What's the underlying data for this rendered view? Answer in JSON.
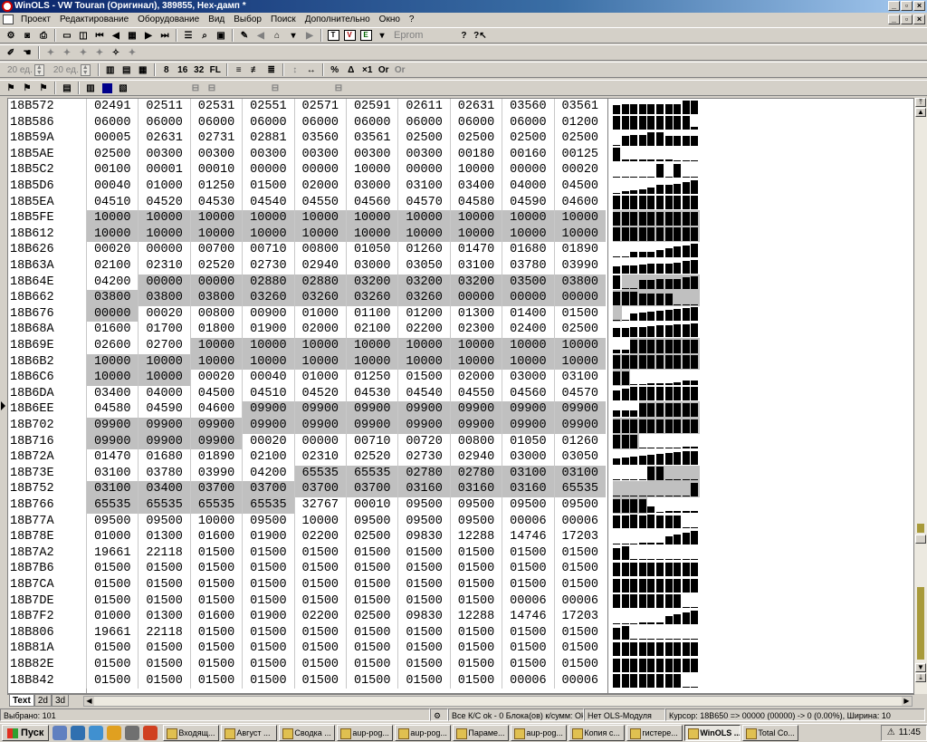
{
  "window": {
    "title": "WinOLS - VW Touran (Оригинал), 389855, Hex-дамп *"
  },
  "menu": [
    "Проект",
    "Редактирование",
    "Оборудование",
    "Вид",
    "Выбор",
    "Поиск",
    "Дополнительно",
    "Окно",
    "?"
  ],
  "toolbar": {
    "eprom_label": "Eprom",
    "step1": "20 ед.",
    "step2": "20 ед."
  },
  "hex": {
    "rows": [
      {
        "addr": "18B572",
        "cells": [
          "02491",
          "02511",
          "02531",
          "02551",
          "02571",
          "02591",
          "02611",
          "02631",
          "03560",
          "03561"
        ],
        "hl": [
          0,
          0,
          0,
          0,
          0,
          0,
          0,
          0,
          0,
          0
        ]
      },
      {
        "addr": "18B586",
        "cells": [
          "06000",
          "06000",
          "06000",
          "06000",
          "06000",
          "06000",
          "06000",
          "06000",
          "06000",
          "01200"
        ],
        "hl": [
          0,
          0,
          0,
          0,
          0,
          0,
          0,
          0,
          0,
          0
        ]
      },
      {
        "addr": "18B59A",
        "cells": [
          "00005",
          "02631",
          "02731",
          "02881",
          "03560",
          "03561",
          "02500",
          "02500",
          "02500",
          "02500"
        ],
        "hl": [
          0,
          0,
          0,
          0,
          0,
          0,
          0,
          0,
          0,
          0
        ]
      },
      {
        "addr": "18B5AE",
        "cells": [
          "02500",
          "00300",
          "00300",
          "00300",
          "00300",
          "00300",
          "00300",
          "00180",
          "00160",
          "00125"
        ],
        "hl": [
          0,
          0,
          0,
          0,
          0,
          0,
          0,
          0,
          0,
          0
        ]
      },
      {
        "addr": "18B5C2",
        "cells": [
          "00100",
          "00001",
          "00010",
          "00000",
          "00000",
          "10000",
          "00000",
          "10000",
          "00000",
          "00020"
        ],
        "hl": [
          0,
          0,
          0,
          0,
          0,
          0,
          0,
          0,
          0,
          0
        ]
      },
      {
        "addr": "18B5D6",
        "cells": [
          "00040",
          "01000",
          "01250",
          "01500",
          "02000",
          "03000",
          "03100",
          "03400",
          "04000",
          "04500"
        ],
        "hl": [
          0,
          0,
          0,
          0,
          0,
          0,
          0,
          0,
          0,
          0
        ]
      },
      {
        "addr": "18B5EA",
        "cells": [
          "04510",
          "04520",
          "04530",
          "04540",
          "04550",
          "04560",
          "04570",
          "04580",
          "04590",
          "04600"
        ],
        "hl": [
          0,
          0,
          0,
          0,
          0,
          0,
          0,
          0,
          0,
          0
        ]
      },
      {
        "addr": "18B5FE",
        "cells": [
          "10000",
          "10000",
          "10000",
          "10000",
          "10000",
          "10000",
          "10000",
          "10000",
          "10000",
          "10000"
        ],
        "hl": [
          1,
          1,
          1,
          1,
          1,
          1,
          1,
          1,
          1,
          1
        ]
      },
      {
        "addr": "18B612",
        "cells": [
          "10000",
          "10000",
          "10000",
          "10000",
          "10000",
          "10000",
          "10000",
          "10000",
          "10000",
          "10000"
        ],
        "hl": [
          1,
          1,
          1,
          1,
          1,
          1,
          1,
          1,
          1,
          1
        ]
      },
      {
        "addr": "18B626",
        "cells": [
          "00020",
          "00000",
          "00700",
          "00710",
          "00800",
          "01050",
          "01260",
          "01470",
          "01680",
          "01890"
        ],
        "hl": [
          0,
          0,
          0,
          0,
          0,
          0,
          0,
          0,
          0,
          0
        ]
      },
      {
        "addr": "18B63A",
        "cells": [
          "02100",
          "02310",
          "02520",
          "02730",
          "02940",
          "03000",
          "03050",
          "03100",
          "03780",
          "03990"
        ],
        "hl": [
          0,
          0,
          0,
          0,
          0,
          0,
          0,
          0,
          0,
          0
        ]
      },
      {
        "addr": "18B64E",
        "cells": [
          "04200",
          "00000",
          "00000",
          "02880",
          "02880",
          "03200",
          "03200",
          "03200",
          "03500",
          "03800"
        ],
        "hl": [
          0,
          1,
          1,
          1,
          1,
          1,
          1,
          1,
          1,
          1
        ]
      },
      {
        "addr": "18B662",
        "cells": [
          "03800",
          "03800",
          "03800",
          "03260",
          "03260",
          "03260",
          "03260",
          "00000",
          "00000",
          "00000"
        ],
        "hl": [
          1,
          1,
          1,
          1,
          1,
          1,
          1,
          1,
          1,
          1
        ]
      },
      {
        "addr": "18B676",
        "cells": [
          "00000",
          "00020",
          "00800",
          "00900",
          "01000",
          "01100",
          "01200",
          "01300",
          "01400",
          "01500"
        ],
        "hl": [
          1,
          0,
          0,
          0,
          0,
          0,
          0,
          0,
          0,
          0
        ]
      },
      {
        "addr": "18B68A",
        "cells": [
          "01600",
          "01700",
          "01800",
          "01900",
          "02000",
          "02100",
          "02200",
          "02300",
          "02400",
          "02500"
        ],
        "hl": [
          0,
          0,
          0,
          0,
          0,
          0,
          0,
          0,
          0,
          0
        ]
      },
      {
        "addr": "18B69E",
        "cells": [
          "02600",
          "02700",
          "10000",
          "10000",
          "10000",
          "10000",
          "10000",
          "10000",
          "10000",
          "10000"
        ],
        "hl": [
          0,
          0,
          1,
          1,
          1,
          1,
          1,
          1,
          1,
          1
        ]
      },
      {
        "addr": "18B6B2",
        "cells": [
          "10000",
          "10000",
          "10000",
          "10000",
          "10000",
          "10000",
          "10000",
          "10000",
          "10000",
          "10000"
        ],
        "hl": [
          1,
          1,
          1,
          1,
          1,
          1,
          1,
          1,
          1,
          1
        ]
      },
      {
        "addr": "18B6C6",
        "cells": [
          "10000",
          "10000",
          "00020",
          "00040",
          "01000",
          "01250",
          "01500",
          "02000",
          "03000",
          "03100"
        ],
        "hl": [
          1,
          1,
          0,
          0,
          0,
          0,
          0,
          0,
          0,
          0
        ]
      },
      {
        "addr": "18B6DA",
        "cells": [
          "03400",
          "04000",
          "04500",
          "04510",
          "04520",
          "04530",
          "04540",
          "04550",
          "04560",
          "04570"
        ],
        "hl": [
          0,
          0,
          0,
          0,
          0,
          0,
          0,
          0,
          0,
          0
        ]
      },
      {
        "addr": "18B6EE",
        "cells": [
          "04580",
          "04590",
          "04600",
          "09900",
          "09900",
          "09900",
          "09900",
          "09900",
          "09900",
          "09900"
        ],
        "hl": [
          0,
          0,
          0,
          1,
          1,
          1,
          1,
          1,
          1,
          1
        ]
      },
      {
        "addr": "18B702",
        "cells": [
          "09900",
          "09900",
          "09900",
          "09900",
          "09900",
          "09900",
          "09900",
          "09900",
          "09900",
          "09900"
        ],
        "hl": [
          1,
          1,
          1,
          1,
          1,
          1,
          1,
          1,
          1,
          1
        ]
      },
      {
        "addr": "18B716",
        "cells": [
          "09900",
          "09900",
          "09900",
          "00020",
          "00000",
          "00710",
          "00720",
          "00800",
          "01050",
          "01260"
        ],
        "hl": [
          1,
          1,
          1,
          0,
          0,
          0,
          0,
          0,
          0,
          0
        ]
      },
      {
        "addr": "18B72A",
        "cells": [
          "01470",
          "01680",
          "01890",
          "02100",
          "02310",
          "02520",
          "02730",
          "02940",
          "03000",
          "03050"
        ],
        "hl": [
          0,
          0,
          0,
          0,
          0,
          0,
          0,
          0,
          0,
          0
        ]
      },
      {
        "addr": "18B73E",
        "cells": [
          "03100",
          "03780",
          "03990",
          "04200",
          "65535",
          "65535",
          "02780",
          "02780",
          "03100",
          "03100"
        ],
        "hl": [
          0,
          0,
          0,
          0,
          1,
          1,
          1,
          1,
          1,
          1
        ]
      },
      {
        "addr": "18B752",
        "cells": [
          "03100",
          "03400",
          "03700",
          "03700",
          "03700",
          "03700",
          "03160",
          "03160",
          "03160",
          "65535"
        ],
        "hl": [
          1,
          1,
          1,
          1,
          1,
          1,
          1,
          1,
          1,
          1
        ]
      },
      {
        "addr": "18B766",
        "cells": [
          "65535",
          "65535",
          "65535",
          "65535",
          "32767",
          "00010",
          "09500",
          "09500",
          "09500",
          "09500"
        ],
        "hl": [
          1,
          1,
          1,
          1,
          0,
          0,
          0,
          0,
          0,
          0
        ]
      },
      {
        "addr": "18B77A",
        "cells": [
          "09500",
          "09500",
          "10000",
          "09500",
          "10000",
          "09500",
          "09500",
          "09500",
          "00006",
          "00006"
        ],
        "hl": [
          0,
          0,
          0,
          0,
          0,
          0,
          0,
          0,
          0,
          0
        ]
      },
      {
        "addr": "18B78E",
        "cells": [
          "01000",
          "01300",
          "01600",
          "01900",
          "02200",
          "02500",
          "09830",
          "12288",
          "14746",
          "17203"
        ],
        "hl": [
          0,
          0,
          0,
          0,
          0,
          0,
          0,
          0,
          0,
          0
        ]
      },
      {
        "addr": "18B7A2",
        "cells": [
          "19661",
          "22118",
          "01500",
          "01500",
          "01500",
          "01500",
          "01500",
          "01500",
          "01500",
          "01500"
        ],
        "hl": [
          0,
          0,
          0,
          0,
          0,
          0,
          0,
          0,
          0,
          0
        ]
      },
      {
        "addr": "18B7B6",
        "cells": [
          "01500",
          "01500",
          "01500",
          "01500",
          "01500",
          "01500",
          "01500",
          "01500",
          "01500",
          "01500"
        ],
        "hl": [
          0,
          0,
          0,
          0,
          0,
          0,
          0,
          0,
          0,
          0
        ]
      },
      {
        "addr": "18B7CA",
        "cells": [
          "01500",
          "01500",
          "01500",
          "01500",
          "01500",
          "01500",
          "01500",
          "01500",
          "01500",
          "01500"
        ],
        "hl": [
          0,
          0,
          0,
          0,
          0,
          0,
          0,
          0,
          0,
          0
        ]
      },
      {
        "addr": "18B7DE",
        "cells": [
          "01500",
          "01500",
          "01500",
          "01500",
          "01500",
          "01500",
          "01500",
          "01500",
          "00006",
          "00006"
        ],
        "hl": [
          0,
          0,
          0,
          0,
          0,
          0,
          0,
          0,
          0,
          0
        ]
      },
      {
        "addr": "18B7F2",
        "cells": [
          "01000",
          "01300",
          "01600",
          "01900",
          "02200",
          "02500",
          "09830",
          "12288",
          "14746",
          "17203"
        ],
        "hl": [
          0,
          0,
          0,
          0,
          0,
          0,
          0,
          0,
          0,
          0
        ]
      },
      {
        "addr": "18B806",
        "cells": [
          "19661",
          "22118",
          "01500",
          "01500",
          "01500",
          "01500",
          "01500",
          "01500",
          "01500",
          "01500"
        ],
        "hl": [
          0,
          0,
          0,
          0,
          0,
          0,
          0,
          0,
          0,
          0
        ]
      },
      {
        "addr": "18B81A",
        "cells": [
          "01500",
          "01500",
          "01500",
          "01500",
          "01500",
          "01500",
          "01500",
          "01500",
          "01500",
          "01500"
        ],
        "hl": [
          0,
          0,
          0,
          0,
          0,
          0,
          0,
          0,
          0,
          0
        ]
      },
      {
        "addr": "18B82E",
        "cells": [
          "01500",
          "01500",
          "01500",
          "01500",
          "01500",
          "01500",
          "01500",
          "01500",
          "01500",
          "01500"
        ],
        "hl": [
          0,
          0,
          0,
          0,
          0,
          0,
          0,
          0,
          0,
          0
        ]
      },
      {
        "addr": "18B842",
        "cells": [
          "01500",
          "01500",
          "01500",
          "01500",
          "01500",
          "01500",
          "01500",
          "01500",
          "00006",
          "00006"
        ],
        "hl": [
          0,
          0,
          0,
          0,
          0,
          0,
          0,
          0,
          0,
          0
        ]
      }
    ]
  },
  "tabs": [
    "Text",
    "2d",
    "3d"
  ],
  "status": {
    "selected": "Выбрано: 101",
    "checksum": "Все К/С ok - 0 Блока(ов) к/сумм: Ok",
    "ols_module": "Нет OLS-Модуля",
    "cursor": "Курсор: 18B650 => 00000 (00000) -> 0 (0.00%), Ширина: 10"
  },
  "taskbar": {
    "start": "Пуск",
    "tasks": [
      "Входящ...",
      "Август ...",
      "Сводка ...",
      "aup-pog...",
      "aup-pog...",
      "Параме...",
      "aup-pog...",
      "Копия с...",
      "гистере...",
      "WinOLS ...",
      "Total Co..."
    ],
    "active_index": 9,
    "clock": "11:45"
  }
}
